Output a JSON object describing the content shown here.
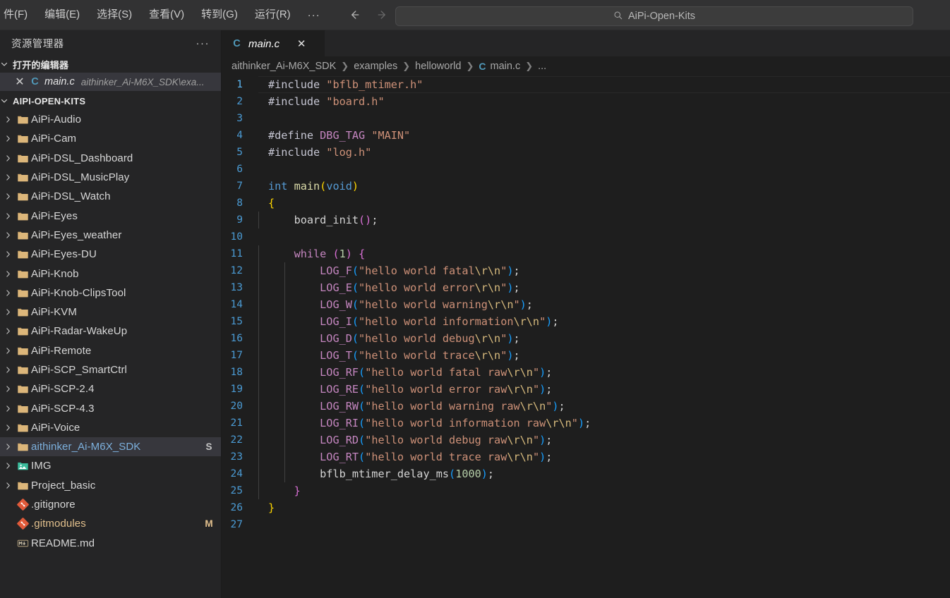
{
  "titlebar": {
    "menu_items": [
      "件(F)",
      "编辑(E)",
      "选择(S)",
      "查看(V)",
      "转到(G)",
      "运行(R)"
    ],
    "more_label": "···",
    "back_icon": "arrow-left-icon",
    "forward_icon": "arrow-right-icon",
    "command_center": {
      "search_icon": "search-icon",
      "text": "AiPi-Open-Kits"
    }
  },
  "sidebar": {
    "title": "资源管理器",
    "actions_label": "···",
    "open_editors": {
      "header": "打开的编辑器",
      "items": [
        {
          "close_glyph": "✕",
          "file_icon": "c-file-icon",
          "icon_letter": "C",
          "name": "main.c",
          "path": "aithinker_Ai-M6X_SDK\\exa..."
        }
      ]
    },
    "workspace": {
      "header": "AIPI-OPEN-KITS",
      "items": [
        {
          "label": "AiPi-Audio",
          "icon": "folder-icon",
          "expandable": true,
          "badge": "",
          "state": "normal"
        },
        {
          "label": "AiPi-Cam",
          "icon": "folder-icon",
          "expandable": true,
          "badge": "",
          "state": "normal"
        },
        {
          "label": "AiPi-DSL_Dashboard",
          "icon": "folder-icon",
          "expandable": true,
          "badge": "",
          "state": "normal"
        },
        {
          "label": "AiPi-DSL_MusicPlay",
          "icon": "folder-icon",
          "expandable": true,
          "badge": "",
          "state": "normal"
        },
        {
          "label": "AiPi-DSL_Watch",
          "icon": "folder-icon",
          "expandable": true,
          "badge": "",
          "state": "normal"
        },
        {
          "label": "AiPi-Eyes",
          "icon": "folder-icon",
          "expandable": true,
          "badge": "",
          "state": "normal"
        },
        {
          "label": "AiPi-Eyes_weather",
          "icon": "folder-icon",
          "expandable": true,
          "badge": "",
          "state": "normal"
        },
        {
          "label": "AiPi-Eyes-DU",
          "icon": "folder-icon",
          "expandable": true,
          "badge": "",
          "state": "normal"
        },
        {
          "label": "AiPi-Knob",
          "icon": "folder-icon",
          "expandable": true,
          "badge": "",
          "state": "normal"
        },
        {
          "label": "AiPi-Knob-ClipsTool",
          "icon": "folder-icon",
          "expandable": true,
          "badge": "",
          "state": "normal"
        },
        {
          "label": "AiPi-KVM",
          "icon": "folder-icon",
          "expandable": true,
          "badge": "",
          "state": "normal"
        },
        {
          "label": "AiPi-Radar-WakeUp",
          "icon": "folder-icon",
          "expandable": true,
          "badge": "",
          "state": "normal"
        },
        {
          "label": "AiPi-Remote",
          "icon": "folder-icon",
          "expandable": true,
          "badge": "",
          "state": "normal"
        },
        {
          "label": "AiPi-SCP_SmartCtrl",
          "icon": "folder-icon",
          "expandable": true,
          "badge": "",
          "state": "normal"
        },
        {
          "label": "AiPi-SCP-2.4",
          "icon": "folder-icon",
          "expandable": true,
          "badge": "",
          "state": "normal"
        },
        {
          "label": "AiPi-SCP-4.3",
          "icon": "folder-icon",
          "expandable": true,
          "badge": "",
          "state": "normal"
        },
        {
          "label": "AiPi-Voice",
          "icon": "folder-icon",
          "expandable": true,
          "badge": "",
          "state": "normal"
        },
        {
          "label": "aithinker_Ai-M6X_SDK",
          "icon": "folder-icon",
          "expandable": true,
          "badge": "S",
          "state": "selected"
        },
        {
          "label": "IMG",
          "icon": "image-folder-icon",
          "expandable": true,
          "badge": "",
          "state": "normal"
        },
        {
          "label": "Project_basic",
          "icon": "folder-icon",
          "expandable": true,
          "badge": "",
          "state": "normal"
        },
        {
          "label": ".gitignore",
          "icon": "git-file-icon",
          "expandable": false,
          "badge": "",
          "state": "normal"
        },
        {
          "label": ".gitmodules",
          "icon": "git-file-icon",
          "expandable": false,
          "badge": "M",
          "state": "modified"
        },
        {
          "label": "README.md",
          "icon": "markdown-icon",
          "expandable": false,
          "badge": "",
          "state": "normal"
        }
      ]
    }
  },
  "editor": {
    "tabs": [
      {
        "icon": "c-file-icon",
        "icon_letter": "C",
        "label": "main.c",
        "close_glyph": "✕",
        "active": true
      }
    ],
    "breadcrumb": {
      "separator": "❯",
      "items": [
        "aithinker_Ai-M6X_SDK",
        "examples",
        "helloworld",
        "main.c",
        "..."
      ],
      "file_icon_letter": "C"
    },
    "active_line": 1,
    "total_lines": 27,
    "language": "c",
    "lines": [
      {
        "n": 1,
        "tokens": [
          {
            "t": "#include ",
            "c": "t-pre"
          },
          {
            "t": "\"bflb_mtimer.h\"",
            "c": "t-str"
          }
        ]
      },
      {
        "n": 2,
        "tokens": [
          {
            "t": "#include ",
            "c": "t-pre"
          },
          {
            "t": "\"board.h\"",
            "c": "t-str"
          }
        ]
      },
      {
        "n": 3,
        "tokens": []
      },
      {
        "n": 4,
        "tokens": [
          {
            "t": "#define ",
            "c": "t-pre"
          },
          {
            "t": "DBG_TAG",
            "c": "t-macro"
          },
          {
            "t": " ",
            "c": "t-plain"
          },
          {
            "t": "\"MAIN\"",
            "c": "t-str"
          }
        ]
      },
      {
        "n": 5,
        "tokens": [
          {
            "t": "#include ",
            "c": "t-pre"
          },
          {
            "t": "\"log.h\"",
            "c": "t-str"
          }
        ]
      },
      {
        "n": 6,
        "tokens": []
      },
      {
        "n": 7,
        "tokens": [
          {
            "t": "int ",
            "c": "t-kw"
          },
          {
            "t": "main",
            "c": "t-fn"
          },
          {
            "t": "(",
            "c": "p1"
          },
          {
            "t": "void",
            "c": "t-kw"
          },
          {
            "t": ")",
            "c": "p1"
          }
        ]
      },
      {
        "n": 8,
        "tokens": [
          {
            "t": "{",
            "c": "p1"
          }
        ]
      },
      {
        "n": 9,
        "tokens": [
          {
            "t": "    board_init",
            "c": "t-id"
          },
          {
            "t": "()",
            "c": "p2"
          },
          {
            "t": ";",
            "c": "t-plain"
          }
        ]
      },
      {
        "n": 10,
        "tokens": []
      },
      {
        "n": 11,
        "tokens": [
          {
            "t": "    ",
            "c": "t-plain"
          },
          {
            "t": "while",
            "c": "t-ctl"
          },
          {
            "t": " ",
            "c": "t-plain"
          },
          {
            "t": "(",
            "c": "p2"
          },
          {
            "t": "1",
            "c": "t-num"
          },
          {
            "t": ")",
            "c": "p2"
          },
          {
            "t": " ",
            "c": "t-plain"
          },
          {
            "t": "{",
            "c": "p2"
          }
        ]
      },
      {
        "n": 12,
        "tokens": [
          {
            "t": "        ",
            "c": "t-plain"
          },
          {
            "t": "LOG_F",
            "c": "t-macro"
          },
          {
            "t": "(",
            "c": "p3"
          },
          {
            "t": "\"hello world fatal",
            "c": "t-str"
          },
          {
            "t": "\\r\\n",
            "c": "t-esc"
          },
          {
            "t": "\"",
            "c": "t-str"
          },
          {
            "t": ")",
            "c": "p3"
          },
          {
            "t": ";",
            "c": "t-plain"
          }
        ]
      },
      {
        "n": 13,
        "tokens": [
          {
            "t": "        ",
            "c": "t-plain"
          },
          {
            "t": "LOG_E",
            "c": "t-macro"
          },
          {
            "t": "(",
            "c": "p3"
          },
          {
            "t": "\"hello world error",
            "c": "t-str"
          },
          {
            "t": "\\r\\n",
            "c": "t-esc"
          },
          {
            "t": "\"",
            "c": "t-str"
          },
          {
            "t": ")",
            "c": "p3"
          },
          {
            "t": ";",
            "c": "t-plain"
          }
        ]
      },
      {
        "n": 14,
        "tokens": [
          {
            "t": "        ",
            "c": "t-plain"
          },
          {
            "t": "LOG_W",
            "c": "t-macro"
          },
          {
            "t": "(",
            "c": "p3"
          },
          {
            "t": "\"hello world warning",
            "c": "t-str"
          },
          {
            "t": "\\r\\n",
            "c": "t-esc"
          },
          {
            "t": "\"",
            "c": "t-str"
          },
          {
            "t": ")",
            "c": "p3"
          },
          {
            "t": ";",
            "c": "t-plain"
          }
        ]
      },
      {
        "n": 15,
        "tokens": [
          {
            "t": "        ",
            "c": "t-plain"
          },
          {
            "t": "LOG_I",
            "c": "t-macro"
          },
          {
            "t": "(",
            "c": "p3"
          },
          {
            "t": "\"hello world information",
            "c": "t-str"
          },
          {
            "t": "\\r\\n",
            "c": "t-esc"
          },
          {
            "t": "\"",
            "c": "t-str"
          },
          {
            "t": ")",
            "c": "p3"
          },
          {
            "t": ";",
            "c": "t-plain"
          }
        ]
      },
      {
        "n": 16,
        "tokens": [
          {
            "t": "        ",
            "c": "t-plain"
          },
          {
            "t": "LOG_D",
            "c": "t-macro"
          },
          {
            "t": "(",
            "c": "p3"
          },
          {
            "t": "\"hello world debug",
            "c": "t-str"
          },
          {
            "t": "\\r\\n",
            "c": "t-esc"
          },
          {
            "t": "\"",
            "c": "t-str"
          },
          {
            "t": ")",
            "c": "p3"
          },
          {
            "t": ";",
            "c": "t-plain"
          }
        ]
      },
      {
        "n": 17,
        "tokens": [
          {
            "t": "        ",
            "c": "t-plain"
          },
          {
            "t": "LOG_T",
            "c": "t-macro"
          },
          {
            "t": "(",
            "c": "p3"
          },
          {
            "t": "\"hello world trace",
            "c": "t-str"
          },
          {
            "t": "\\r\\n",
            "c": "t-esc"
          },
          {
            "t": "\"",
            "c": "t-str"
          },
          {
            "t": ")",
            "c": "p3"
          },
          {
            "t": ";",
            "c": "t-plain"
          }
        ]
      },
      {
        "n": 18,
        "tokens": [
          {
            "t": "        ",
            "c": "t-plain"
          },
          {
            "t": "LOG_RF",
            "c": "t-macro"
          },
          {
            "t": "(",
            "c": "p3"
          },
          {
            "t": "\"hello world fatal raw",
            "c": "t-str"
          },
          {
            "t": "\\r\\n",
            "c": "t-esc"
          },
          {
            "t": "\"",
            "c": "t-str"
          },
          {
            "t": ")",
            "c": "p3"
          },
          {
            "t": ";",
            "c": "t-plain"
          }
        ]
      },
      {
        "n": 19,
        "tokens": [
          {
            "t": "        ",
            "c": "t-plain"
          },
          {
            "t": "LOG_RE",
            "c": "t-macro"
          },
          {
            "t": "(",
            "c": "p3"
          },
          {
            "t": "\"hello world error raw",
            "c": "t-str"
          },
          {
            "t": "\\r\\n",
            "c": "t-esc"
          },
          {
            "t": "\"",
            "c": "t-str"
          },
          {
            "t": ")",
            "c": "p3"
          },
          {
            "t": ";",
            "c": "t-plain"
          }
        ]
      },
      {
        "n": 20,
        "tokens": [
          {
            "t": "        ",
            "c": "t-plain"
          },
          {
            "t": "LOG_RW",
            "c": "t-macro"
          },
          {
            "t": "(",
            "c": "p3"
          },
          {
            "t": "\"hello world warning raw",
            "c": "t-str"
          },
          {
            "t": "\\r\\n",
            "c": "t-esc"
          },
          {
            "t": "\"",
            "c": "t-str"
          },
          {
            "t": ")",
            "c": "p3"
          },
          {
            "t": ";",
            "c": "t-plain"
          }
        ]
      },
      {
        "n": 21,
        "tokens": [
          {
            "t": "        ",
            "c": "t-plain"
          },
          {
            "t": "LOG_RI",
            "c": "t-macro"
          },
          {
            "t": "(",
            "c": "p3"
          },
          {
            "t": "\"hello world information raw",
            "c": "t-str"
          },
          {
            "t": "\\r\\n",
            "c": "t-esc"
          },
          {
            "t": "\"",
            "c": "t-str"
          },
          {
            "t": ")",
            "c": "p3"
          },
          {
            "t": ";",
            "c": "t-plain"
          }
        ]
      },
      {
        "n": 22,
        "tokens": [
          {
            "t": "        ",
            "c": "t-plain"
          },
          {
            "t": "LOG_RD",
            "c": "t-macro"
          },
          {
            "t": "(",
            "c": "p3"
          },
          {
            "t": "\"hello world debug raw",
            "c": "t-str"
          },
          {
            "t": "\\r\\n",
            "c": "t-esc"
          },
          {
            "t": "\"",
            "c": "t-str"
          },
          {
            "t": ")",
            "c": "p3"
          },
          {
            "t": ";",
            "c": "t-plain"
          }
        ]
      },
      {
        "n": 23,
        "tokens": [
          {
            "t": "        ",
            "c": "t-plain"
          },
          {
            "t": "LOG_RT",
            "c": "t-macro"
          },
          {
            "t": "(",
            "c": "p3"
          },
          {
            "t": "\"hello world trace raw",
            "c": "t-str"
          },
          {
            "t": "\\r\\n",
            "c": "t-esc"
          },
          {
            "t": "\"",
            "c": "t-str"
          },
          {
            "t": ")",
            "c": "p3"
          },
          {
            "t": ";",
            "c": "t-plain"
          }
        ]
      },
      {
        "n": 24,
        "tokens": [
          {
            "t": "        bflb_mtimer_delay_ms",
            "c": "t-id"
          },
          {
            "t": "(",
            "c": "p3"
          },
          {
            "t": "1000",
            "c": "t-num"
          },
          {
            "t": ")",
            "c": "p3"
          },
          {
            "t": ";",
            "c": "t-plain"
          }
        ]
      },
      {
        "n": 25,
        "tokens": [
          {
            "t": "    ",
            "c": "t-plain"
          },
          {
            "t": "}",
            "c": "p2"
          }
        ]
      },
      {
        "n": 26,
        "tokens": [
          {
            "t": "}",
            "c": "p1"
          }
        ]
      },
      {
        "n": 27,
        "tokens": []
      }
    ]
  },
  "colors": {
    "editor_bg": "#1e1e1e",
    "sidebar_bg": "#252526",
    "titlebar_bg": "#323233",
    "accent_blue": "#519aba",
    "selection_bg": "#37373d",
    "modified": "#e2c08d",
    "string": "#ce9178",
    "macro": "#c586c0",
    "number": "#b5cea8",
    "keyword": "#569cd6",
    "linenumber": "#4b9bd4"
  }
}
